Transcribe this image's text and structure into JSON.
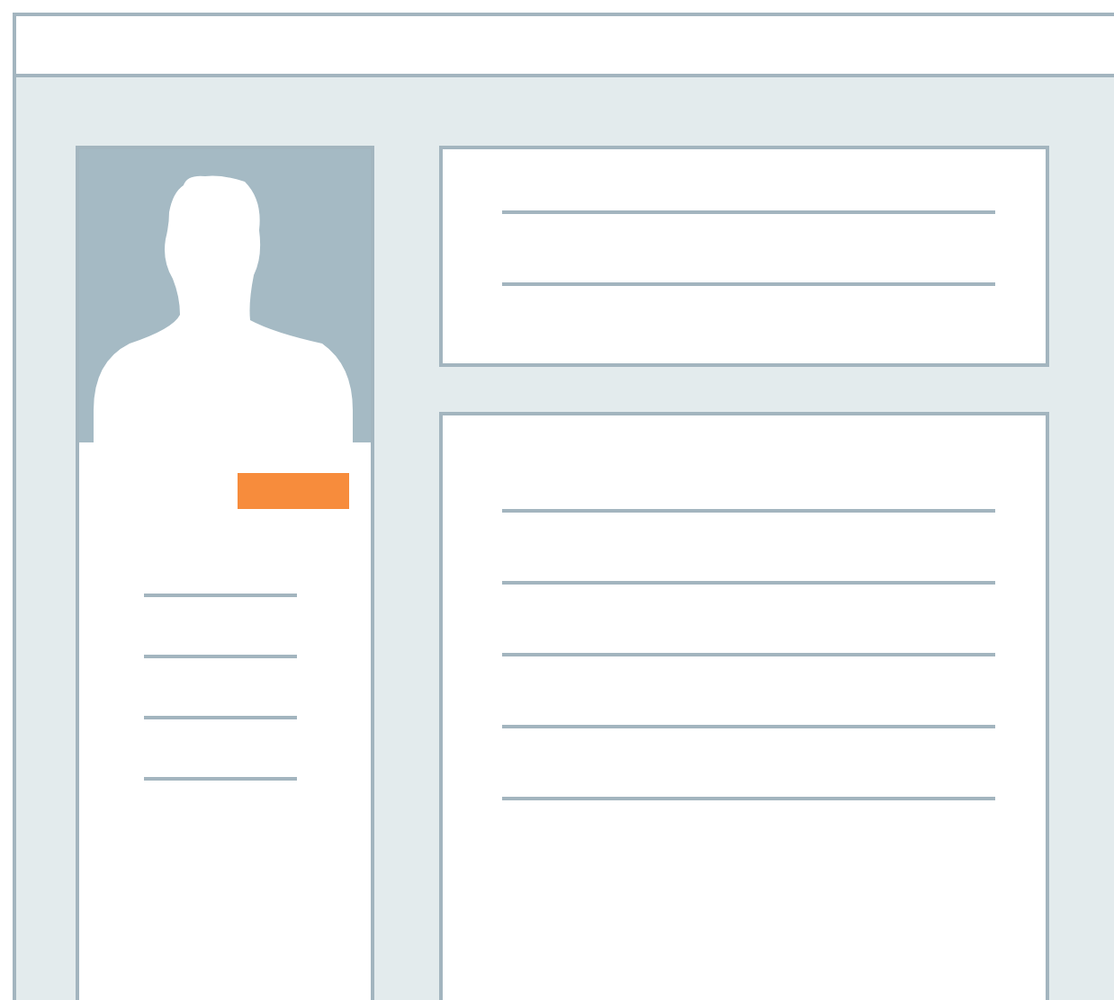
{
  "header": {
    "kind": "bar"
  },
  "profile": {
    "button": {
      "kind": "button"
    },
    "lines": [
      {
        "kind": "line"
      },
      {
        "kind": "line"
      },
      {
        "kind": "line"
      },
      {
        "kind": "line"
      }
    ]
  },
  "summary_card": {
    "lines": [
      {
        "kind": "line"
      },
      {
        "kind": "line"
      }
    ]
  },
  "details_card": {
    "lines": [
      {
        "kind": "line"
      },
      {
        "kind": "line"
      },
      {
        "kind": "line"
      },
      {
        "kind": "line"
      },
      {
        "kind": "line"
      }
    ]
  }
}
